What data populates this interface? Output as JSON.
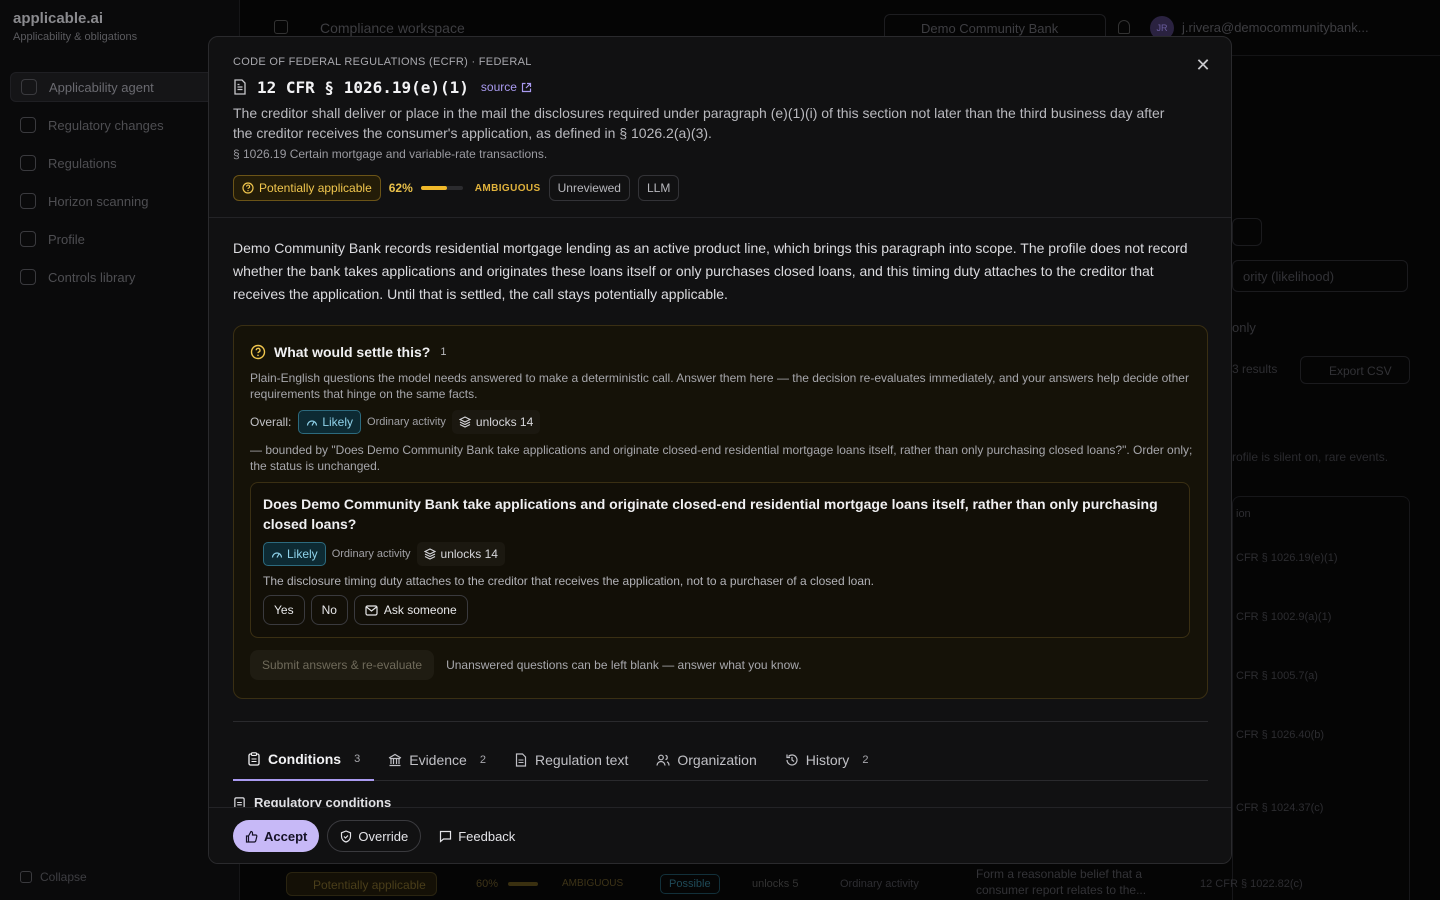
{
  "background": {
    "brand": {
      "name": "applicable.ai",
      "subtitle": "Applicability & obligations"
    },
    "nav": [
      {
        "label": "Applicability agent",
        "icon": "agent-icon"
      },
      {
        "label": "Regulatory changes",
        "icon": "bell-icon"
      },
      {
        "label": "Regulations",
        "icon": "book-icon"
      },
      {
        "label": "Horizon scanning",
        "icon": "radar-icon"
      },
      {
        "label": "Profile",
        "icon": "building-icon"
      },
      {
        "label": "Controls library",
        "icon": "list-icon"
      }
    ],
    "collapse_label": "Collapse",
    "topbar": {
      "workspace": "Compliance workspace",
      "bank": "Demo Community Bank",
      "avatar_initials": "JR",
      "email": "j.rivera@democommunitybank..."
    },
    "panel": {
      "sort_label": "ority (likelihood)",
      "only_label": "only",
      "results_label": "3 results",
      "export_label": "Export CSV",
      "note": "rofile is silent on, rare events.",
      "table_header": "ion",
      "citations": [
        "CFR § 1026.19(e)(1)",
        "CFR § 1002.9(a)(1)",
        "CFR § 1005.7(a)",
        "CFR § 1026.40(b)",
        "CFR § 1024.37(c)"
      ]
    },
    "bottom_row": {
      "badge": "Potentially applicable",
      "pct": "60%",
      "amb": "AMBIGUOUS",
      "possible": "Possible",
      "unlocks": "unlocks 5",
      "ordinary": "Ordinary activity",
      "desc": "Form a reasonable belief that a consumer report relates to the...",
      "cite": "12 CFR § 1022.82(c)"
    }
  },
  "modal": {
    "source_line": "CODE OF FEDERAL REGULATIONS (ECFR) · FEDERAL",
    "citation": "12 CFR § 1026.19(e)(1)",
    "source_link": "source",
    "paragraph": "The creditor shall deliver or place in the mail the disclosures required under paragraph (e)(1)(i) of this section not later than the third business day after the creditor receives the consumer's application, as defined in § 1026.2(a)(3).",
    "section": "§ 1026.19 Certain mortgage and variable-rate transactions.",
    "status": "Potentially applicable",
    "confidence_label": "62%",
    "confidence": 0.62,
    "ambiguity": "AMBIGUOUS",
    "review": "Unreviewed",
    "method": "LLM",
    "rationale": "Demo Community Bank records residential mortgage lending as an active product line, which brings this paragraph into scope. The profile does not record whether the bank takes applications and originates these loans itself or only purchases closed loans, and this timing duty attaches to the creditor that receives the application. Until that is settled, the call stays potentially applicable.",
    "settle": {
      "title": "What would settle this?",
      "count": "1",
      "description": "Plain-English questions the model needs answered to make a deterministic call. Answer them here — the decision re-evaluates immediately, and your answers help decide other requirements that hinge on the same facts.",
      "overall_label": "Overall:",
      "likelihood": "Likely",
      "activity": "Ordinary activity",
      "unlocks": "unlocks 14",
      "bounded": "— bounded by \"Does Demo Community Bank take applications and originate closed-end residential mortgage loans itself, rather than only purchasing closed loans?\". Order only; the status is unchanged.",
      "question": {
        "text": "Does Demo Community Bank take applications and originate closed-end residential mortgage loans itself, rather than only purchasing closed loans?",
        "likelihood": "Likely",
        "activity": "Ordinary activity",
        "unlocks": "unlocks 14",
        "reason": "The disclosure timing duty attaches to the creditor that receives the application, not to a purchaser of a closed loan.",
        "yes": "Yes",
        "no": "No",
        "ask": "Ask someone"
      },
      "submit": "Submit answers & re-evaluate",
      "submit_note": "Unanswered questions can be left blank — answer what you know."
    },
    "tabs": [
      {
        "label": "Conditions",
        "count": "3"
      },
      {
        "label": "Evidence",
        "count": "2"
      },
      {
        "label": "Regulation text",
        "count": ""
      },
      {
        "label": "Organization",
        "count": ""
      },
      {
        "label": "History",
        "count": "2"
      }
    ],
    "subheading": "Regulatory conditions",
    "footer": {
      "accept": "Accept",
      "override": "Override",
      "feedback": "Feedback"
    },
    "colors": {
      "accent": "#a99af0",
      "warning": "#f0c64e",
      "likely": "#8fd2ea"
    }
  }
}
